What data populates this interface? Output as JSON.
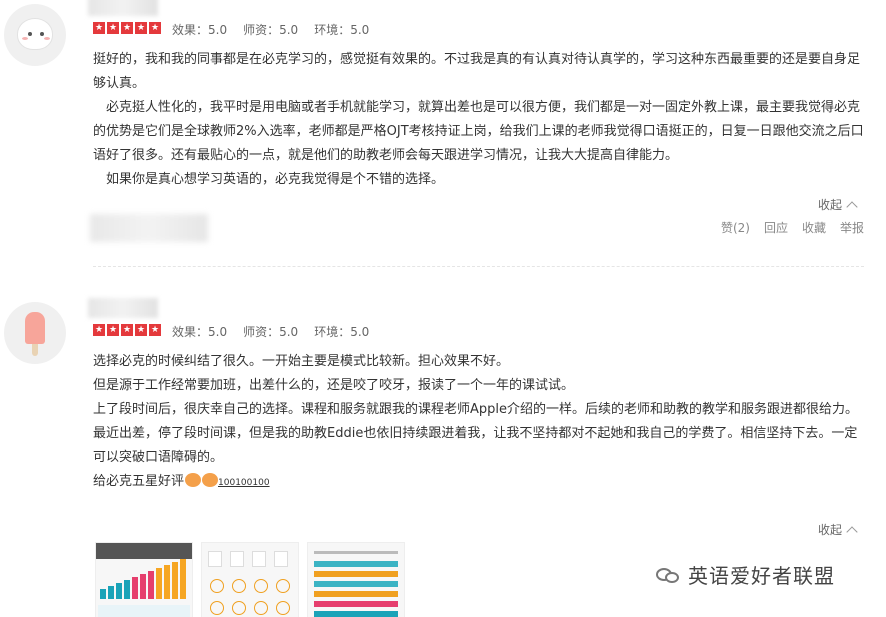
{
  "reviews": [
    {
      "scores": {
        "effect": "效果：5.0",
        "teachers": "师资：5.0",
        "environment": "环境：5.0"
      },
      "paragraphs": [
        "挺好的，我和我的同事都是在必克学习的，感觉挺有效果的。不过我是真的有认真对待认真学的，学习这种东西最重要的还是要自身足够认真。",
        "　必克挺人性化的，我平时是用电脑或者手机就能学习，就算出差也是可以很方便，我们都是一对一固定外教上课，最主要我觉得必克的优势是它们是全球教师2%入选率，老师都是严格OJT考核持证上岗，给我们上课的老师我觉得口语挺正的，日复一日跟他交流之后口语好了很多。还有最贴心的一点，就是他们的助教老师会每天跟进学习情况，让我大大提高自律能力。",
        "　如果你是真心想学习英语的，必克我觉得是个不错的选择。"
      ],
      "collapse_label": "收起",
      "actions": {
        "like": "赞(2)",
        "reply": "回应",
        "favorite": "收藏",
        "report": "举报"
      }
    },
    {
      "scores": {
        "effect": "效果：5.0",
        "teachers": "师资：5.0",
        "environment": "环境：5.0"
      },
      "paragraphs": [
        "选择必克的时候纠结了很久。一开始主要是模式比较新。担心效果不好。",
        "但是源于工作经常要加班，出差什么的，还是咬了咬牙，报读了一个一年的课试试。",
        "上了段时间后，很庆幸自己的选择。课程和服务就跟我的课程老师Apple介绍的一样。后续的老师和助教的教学和服务跟进都很给力。",
        "最近出差，停了段时间课，但是我的助教Eddie也依旧持续跟进着我，让我不坚持都对不起她和我自己的学费了。相信坚持下去。一定可以突破口语障碍的。"
      ],
      "last_line": "给必克五星好评",
      "hundred_text": "100100100",
      "collapse_label": "收起"
    }
  ],
  "watermark": {
    "text": "英语爱好者联盟",
    "icon": "wechat-icon"
  },
  "colors": {
    "star": "#e4393c",
    "text": "#333333",
    "muted": "#888888"
  }
}
